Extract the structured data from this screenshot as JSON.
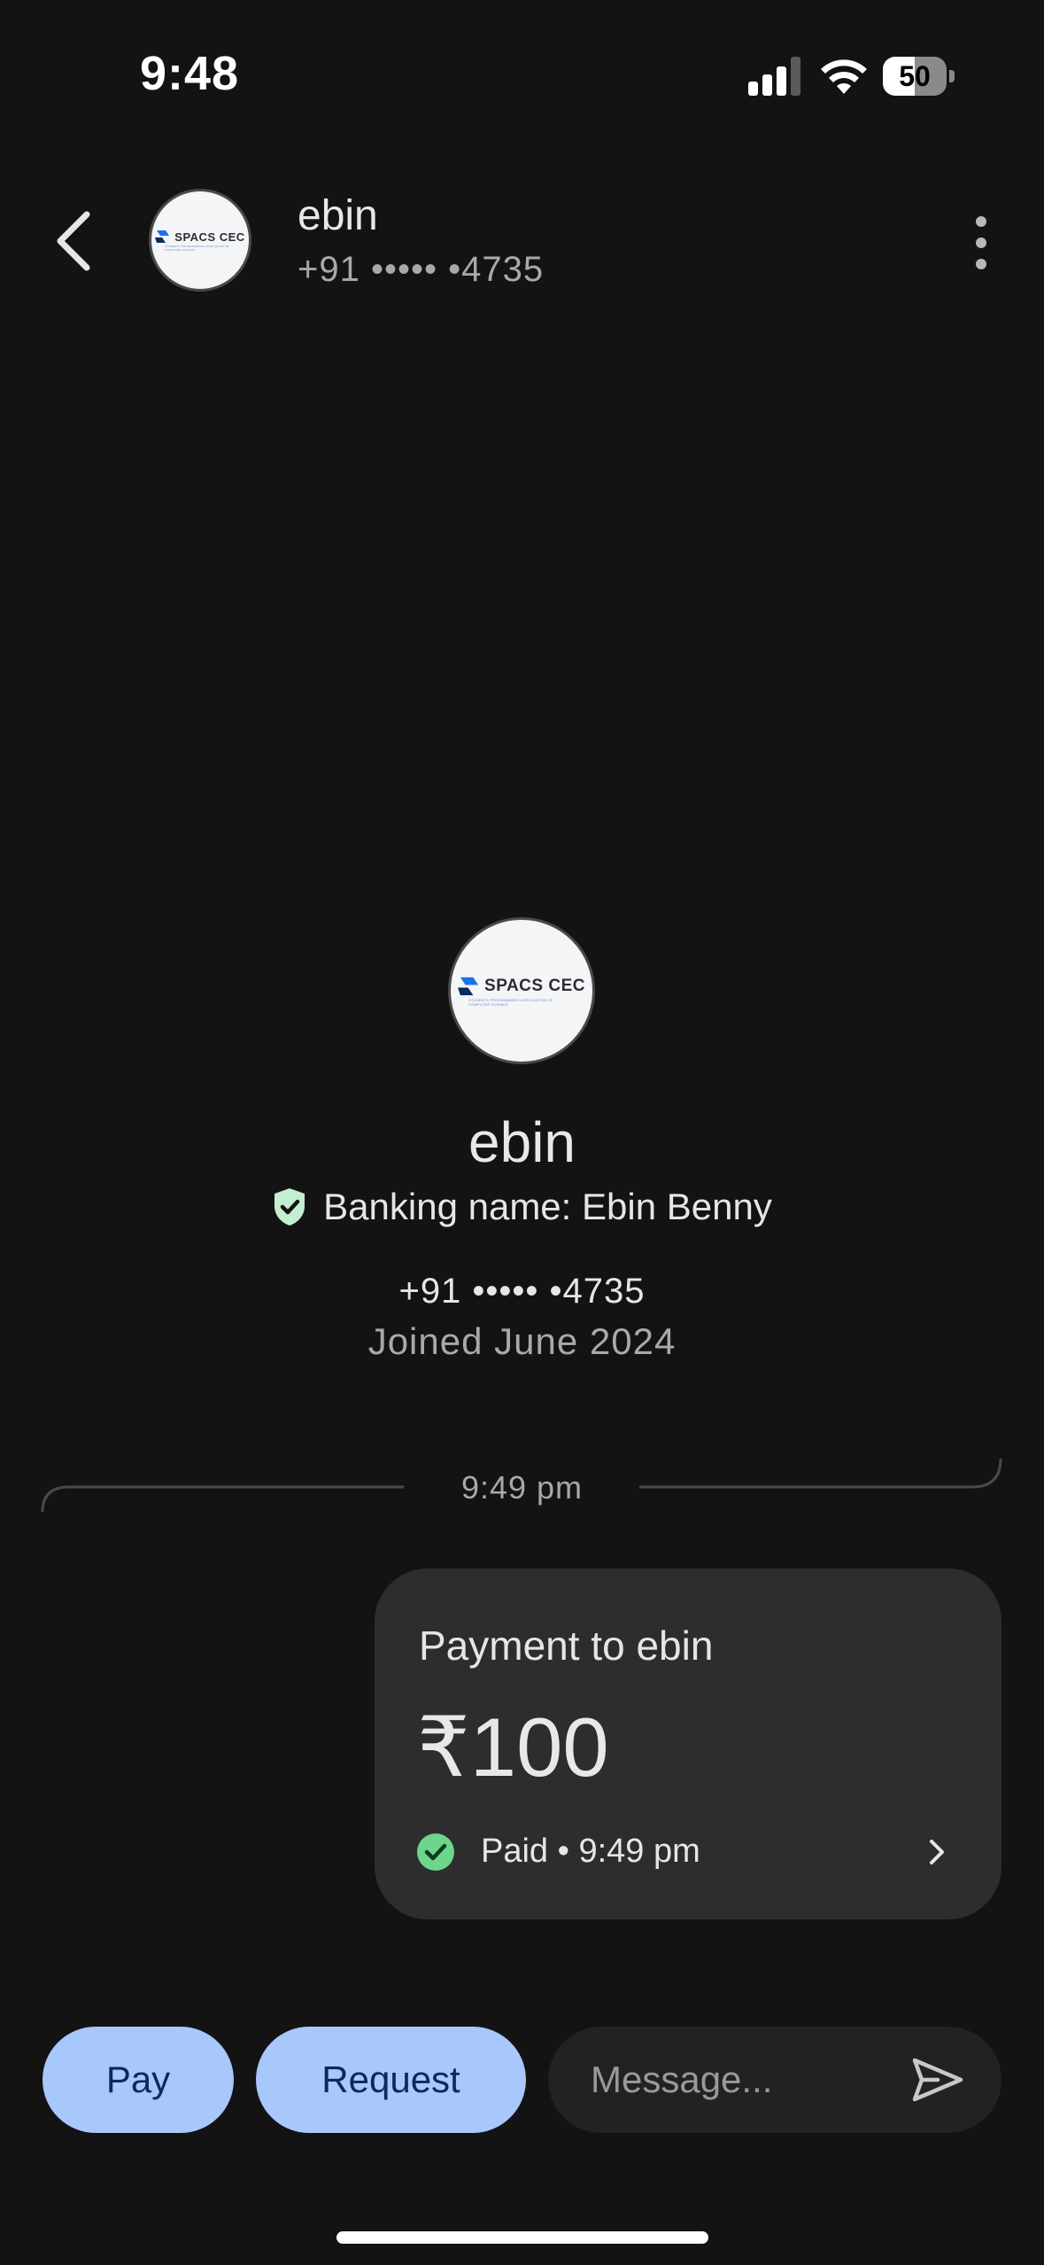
{
  "status_bar": {
    "time": "9:48",
    "battery_level": "50",
    "battery_fraction": 0.5,
    "icons": [
      "signal-icon",
      "wifi-icon",
      "battery-icon"
    ]
  },
  "header": {
    "name": "ebin",
    "phone": "+91 ••••• •4735",
    "icons": [
      "back-arrow-icon",
      "more-vert-icon"
    ]
  },
  "avatar_logo": {
    "title": "SPACS CEC",
    "subtitle": "STUDENTS PROGRAMMING ASSOCIATION OF COMPUTER SCIENCE"
  },
  "profile": {
    "name": "ebin",
    "banking_label": "Banking name: Ebin  Benny",
    "phone": "+91 ••••• •4735",
    "joined": "Joined June 2024",
    "icons": [
      "verified-shield-icon"
    ]
  },
  "conversation": {
    "divider_time": "9:49 pm",
    "payment": {
      "title": "Payment to ebin",
      "amount": "₹100",
      "status": "Paid • 9:49 pm",
      "icons": [
        "check-circle-icon",
        "chevron-right-icon"
      ]
    }
  },
  "bottom_bar": {
    "pay_label": "Pay",
    "request_label": "Request",
    "message_placeholder": "Message...",
    "icons": [
      "send-icon"
    ]
  },
  "colors": {
    "background": "#131314",
    "card": "#2d2d2e",
    "button": "#a8c7fa",
    "button_text": "#0b2a5a",
    "paid_green": "#6dd58c",
    "shield_green": "#c4eed0"
  }
}
